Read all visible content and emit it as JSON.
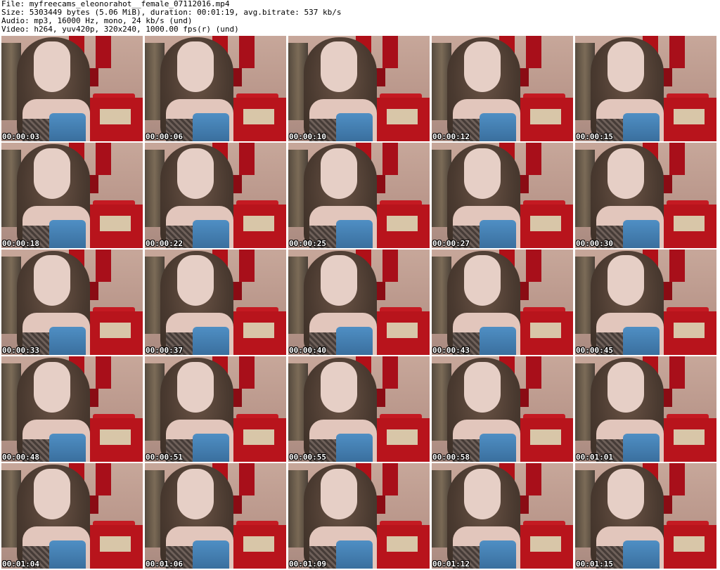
{
  "header": {
    "file": "File: myfreecams_eleonorahot__female_07112016.mp4",
    "size": "Size: 5303449 bytes (5.06 MiB), duration: 00:01:19, avg.bitrate: 537 kb/s",
    "audio": "Audio: mp3, 16000 Hz, mono, 24 kb/s (und)",
    "video": "Video: h264, yuv420p, 320x240, 1000.00 fps(r) (und)"
  },
  "thumbnails": [
    "00:00:03",
    "00:00:06",
    "00:00:10",
    "00:00:12",
    "00:00:15",
    "00:00:18",
    "00:00:22",
    "00:00:25",
    "00:00:27",
    "00:00:30",
    "00:00:33",
    "00:00:37",
    "00:00:40",
    "00:00:43",
    "00:00:45",
    "00:00:48",
    "00:00:51",
    "00:00:55",
    "00:00:58",
    "00:01:01",
    "00:01:04",
    "00:01:06",
    "00:01:09",
    "00:01:12",
    "00:01:15"
  ]
}
